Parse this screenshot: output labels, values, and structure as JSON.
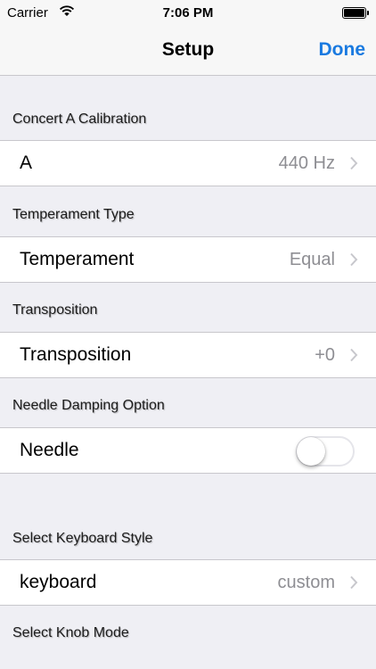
{
  "status_bar": {
    "carrier": "Carrier",
    "time": "7:06 PM",
    "icons": [
      "wifi-icon",
      "battery-icon"
    ]
  },
  "nav": {
    "title": "Setup",
    "done_label": "Done",
    "accent_color": "#1a7ae0"
  },
  "sections": {
    "calibration": {
      "header": "Concert A Calibration",
      "label": "A",
      "value": "440 Hz"
    },
    "temperament": {
      "header": "Temperament Type",
      "label": "Temperament",
      "value": "Equal"
    },
    "transposition": {
      "header": "Transposition",
      "label": "Transposition",
      "value": "+0"
    },
    "needle": {
      "header": "Needle Damping Option",
      "label": "Needle",
      "toggle_on": false
    },
    "keyboard": {
      "header": "Select Keyboard Style",
      "label": "keyboard",
      "value": "custom"
    },
    "knob": {
      "header": "Select Knob Mode"
    }
  }
}
